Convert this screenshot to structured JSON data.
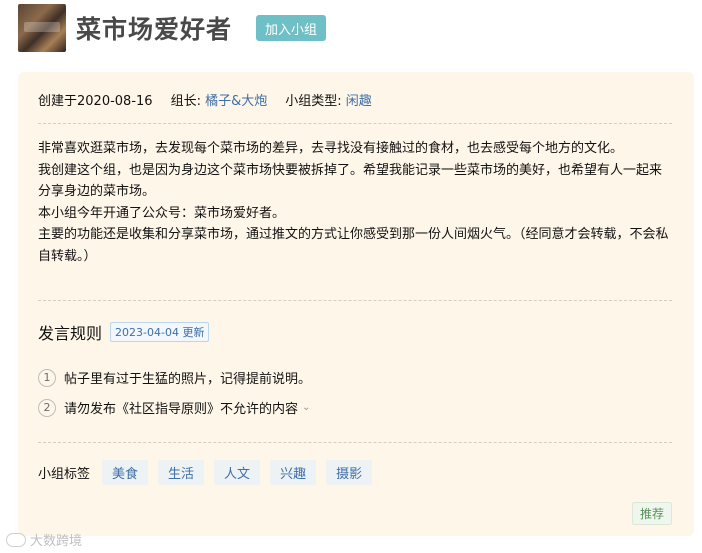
{
  "header": {
    "group_name": "菜市场爱好者",
    "join_label": "加入小组"
  },
  "meta": {
    "created": "创建于2020-08-16",
    "leader_label": "组长:",
    "leader_name": "橘子&大炮",
    "type_label": "小组类型:",
    "type_value": "闲趣"
  },
  "intro": {
    "lines": [
      "非常喜欢逛菜市场，去发现每个菜市场的差异，去寻找没有接触过的食材，也去感受每个地方的文化。",
      "我创建这个组，也是因为身边这个菜市场快要被拆掉了。希望我能记录一些菜市场的美好，也希望有人一起来分享身边的菜市场。",
      "本小组今年开通了公众号：菜市场爱好者。",
      "主要的功能还是收集和分享菜市场，通过推文的方式让你感受到那一份人间烟火气。（经同意才会转载，不会私自转载。）"
    ]
  },
  "rules": {
    "title": "发言规则",
    "updated": "2023-04-04 更新",
    "items": [
      {
        "num": "1",
        "text": "帖子里有过于生猛的照片，记得提前说明。"
      },
      {
        "num": "2",
        "text": "请勿发布《社区指导原则》不允许的内容"
      }
    ]
  },
  "tags": {
    "label": "小组标签",
    "items": [
      "美食",
      "生活",
      "人文",
      "兴趣",
      "摄影"
    ]
  },
  "recommend_label": "推荐",
  "watermark": "大数跨境",
  "icons": {
    "chevron": "chevron-down-icon",
    "watermark": "brand-logo-icon"
  }
}
